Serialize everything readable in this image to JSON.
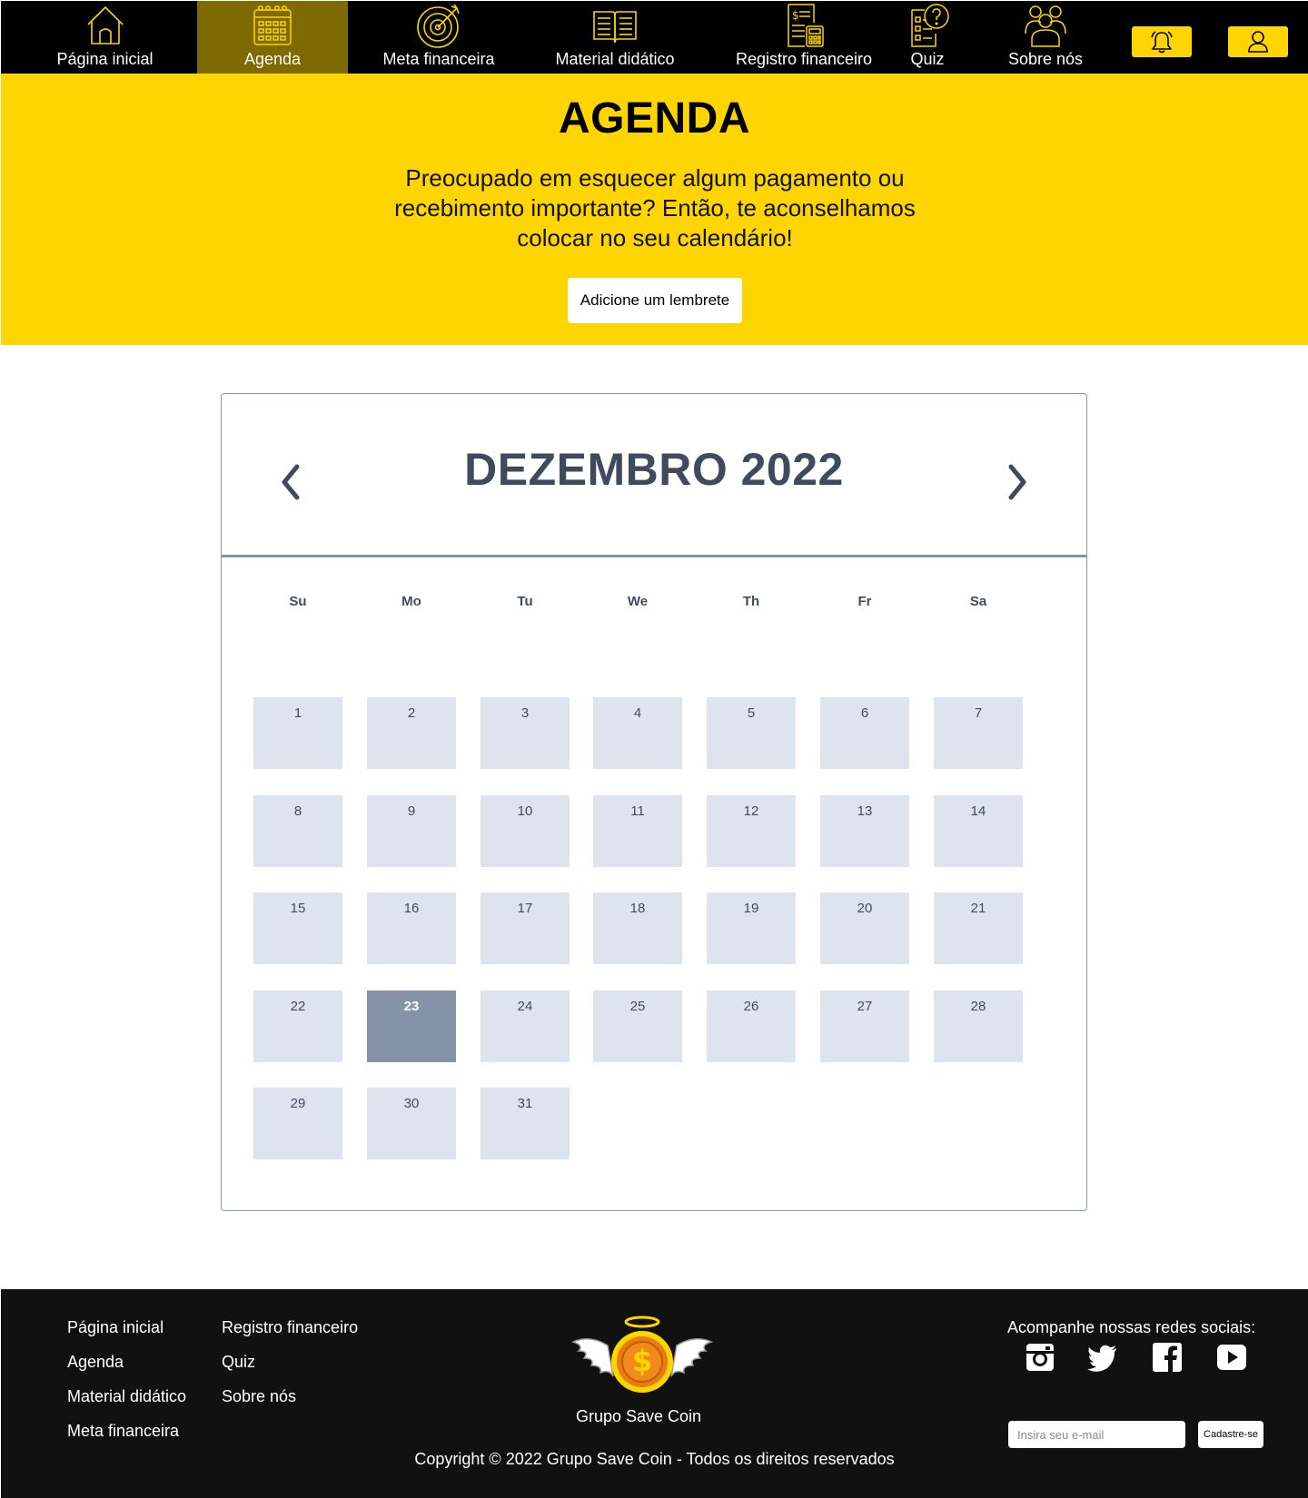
{
  "nav": {
    "items": [
      {
        "label": "Página inicial",
        "icon": "home-icon"
      },
      {
        "label": "Agenda",
        "icon": "calendar-icon",
        "active": true
      },
      {
        "label": "Meta financeira",
        "icon": "target-icon"
      },
      {
        "label": "Material didático",
        "icon": "book-icon"
      },
      {
        "label": "Registro financeiro",
        "icon": "receipt-calculator-icon"
      },
      {
        "label": "Quiz",
        "icon": "quiz-icon"
      },
      {
        "label": "Sobre nós",
        "icon": "group-icon"
      }
    ],
    "notification_icon": "bell-icon",
    "profile_icon": "user-icon",
    "colors": {
      "bar": "#000000",
      "active": "#7f6a00",
      "accent": "#ffd500"
    }
  },
  "hero": {
    "title": "AGENDA",
    "text": "Preocupado em esquecer algum pagamento ou recebimento importante? Então, te aconselhamos colocar no seu calendário!",
    "button": "Adicione um lembrete"
  },
  "calendar": {
    "month_title": "DEZEMBRO 2022",
    "prev_icon": "chevron-left-icon",
    "next_icon": "chevron-right-icon",
    "weekdays": [
      "Su",
      "Mo",
      "Tu",
      "We",
      "Th",
      "Fr",
      "Sa"
    ],
    "days": [
      "1",
      "2",
      "3",
      "4",
      "5",
      "6",
      "7",
      "8",
      "9",
      "10",
      "11",
      "12",
      "13",
      "14",
      "15",
      "16",
      "17",
      "18",
      "19",
      "20",
      "21",
      "22",
      "23",
      "24",
      "25",
      "26",
      "27",
      "28",
      "29",
      "30",
      "31"
    ],
    "first_weekday_index": 4,
    "selected_day": "23",
    "colors": {
      "day_bg": "#dee4ed",
      "selected_bg": "#8493a8",
      "text": "#3f4b5c"
    }
  },
  "footer": {
    "links_col1": [
      "Página inicial",
      "Agenda",
      "Material didático",
      "Meta financeira"
    ],
    "links_col2": [
      "Registro financeiro",
      "Quiz",
      "Sobre nós"
    ],
    "brand": "Grupo Save Coin",
    "logo_icon": "winged-coin-logo",
    "copyright": "Copyright © 2022 Grupo Save Coin - Todos os direitos reservados",
    "social_title": "Acompanhe nossas redes sociais:",
    "social_icons": [
      "instagram-icon",
      "twitter-icon",
      "facebook-icon",
      "youtube-icon"
    ],
    "email_placeholder": "Insira seu e-mail",
    "submit": "Cadastre-se"
  }
}
